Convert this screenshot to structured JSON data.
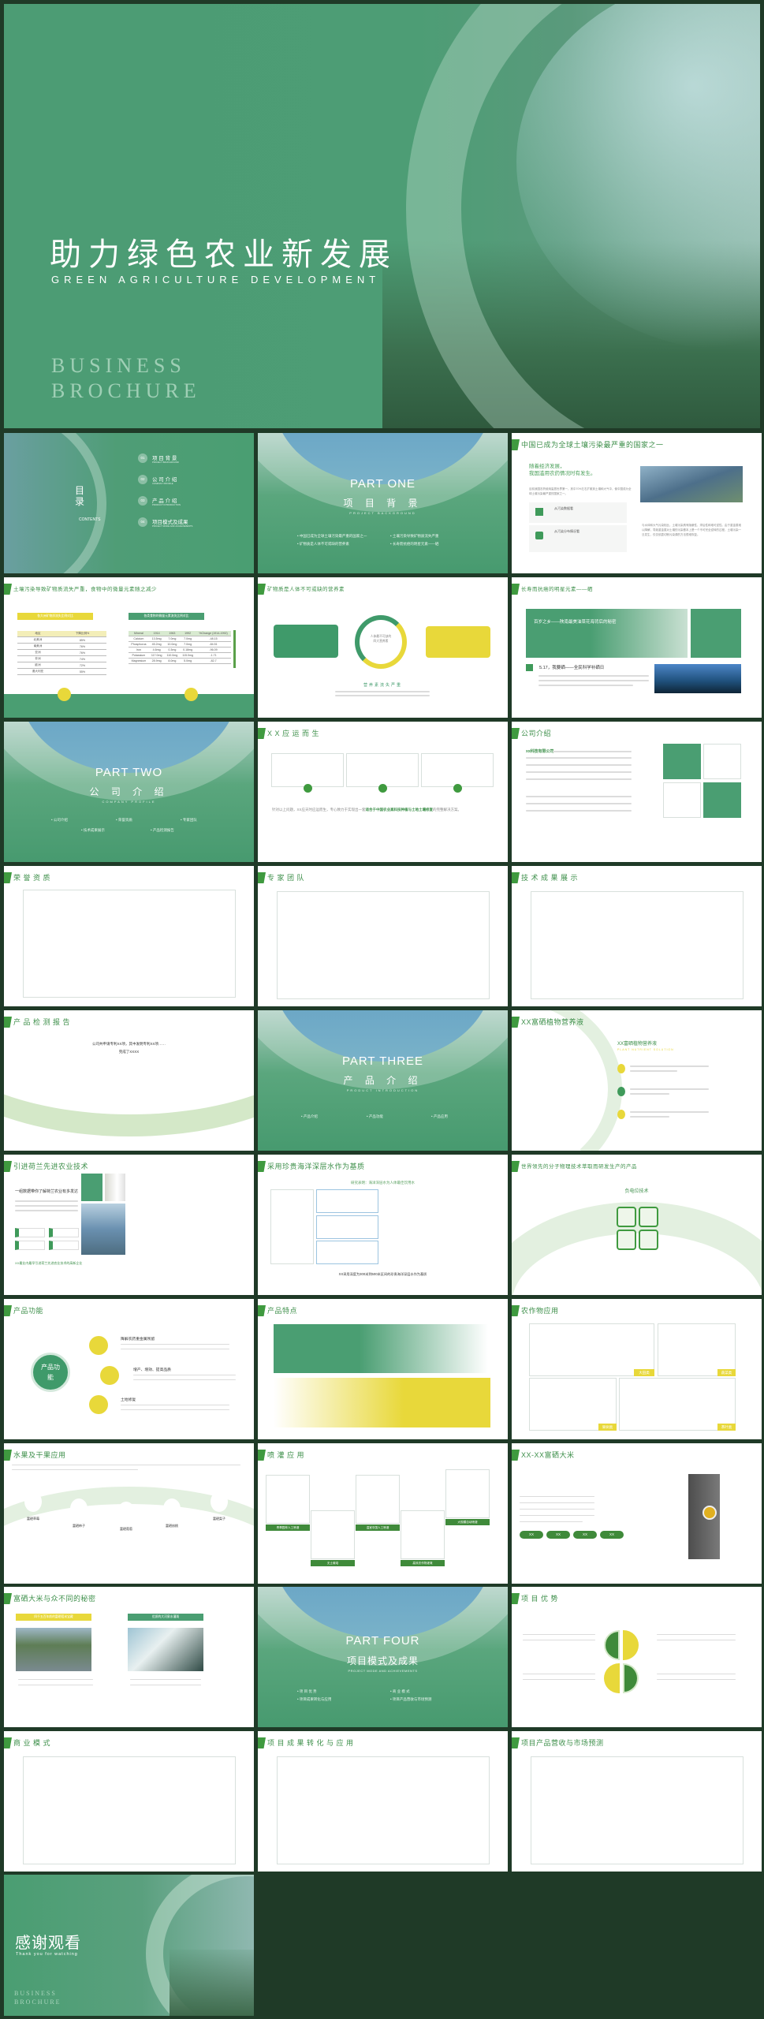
{
  "colors": {
    "background": "#1f3a27",
    "green": "#4a9e72",
    "title_green": "#3d8f4a",
    "yellow": "#e8d83a"
  },
  "cover": {
    "title": "助力绿色农业新发展",
    "subtitle": "GREEN AGRICULTURE DEVELOPMENT",
    "brand1": "BUSINESS",
    "brand2": "BROCHURE"
  },
  "contents": {
    "label_cn": "目录",
    "label_en": "CONTENTS",
    "items": [
      {
        "num": "01",
        "cn": "项 目 背 景",
        "en": "PROJECT BACKGROUND"
      },
      {
        "num": "02",
        "cn": "公 司 介 绍",
        "en": "COMPANY PROFILE"
      },
      {
        "num": "03",
        "cn": "产 品 介 绍",
        "en": "PRODUCT INTRODUCTION"
      },
      {
        "num": "04",
        "cn": "项目模式及成果",
        "en": "PROJECT MODE AND ACHIEVEMENTS"
      }
    ]
  },
  "part1": {
    "part": "PART ONE",
    "cn": "项 目 背 景",
    "en": "PROJECT BACKGROUND",
    "bullets": [
      "中国已成为全球土壤污染最严重的国家之一",
      "土壤污染导致矿物质流失严重",
      "矿物质是人体不可或缺的营养素",
      "长寿而抗癌的明星元素——硒"
    ]
  },
  "s3": {
    "title": "中国已成为全球土壤污染最严重的国家之一",
    "heading1": "随着经济发展，",
    "heading2": "我国滥用农药情况时有发生。",
    "para": "目前我国农药使用量居世界第一，其中70%左右扩散到土壤和大气中，使中国成为全球土壤污染最严重的国家之一。",
    "card1": "从污染数据看",
    "card2": "从污染分布情况看",
    "right": "与水体和大气污染相比，土壤污染具有隐蔽性、滞后性和难可逆性。由于重金属难以降解，导致重金属对土壤的污染基本上是一个不可完全逆转的过程，土壤污染一旦发生，仅仅依靠切断污染源的方法很难恢复。"
  },
  "s4": {
    "title": "土壤污染导致矿物质流失严重，食物中的微量元素随之减少",
    "left_tag": "各大洲矿物质流失比例对比",
    "left_head": [
      "地区",
      "下降比例%"
    ],
    "left_rows": [
      [
        "北美洲",
        "85%"
      ],
      [
        "南美洲",
        "76%"
      ],
      [
        "亚洲",
        "76%"
      ],
      [
        "非洲",
        "74%"
      ],
      [
        "欧洲",
        "72%"
      ],
      [
        "澳大利亚",
        "55%"
      ]
    ],
    "right_tag": "各类食物的微量元素流失比例对比",
    "right_head": [
      "Mineral",
      "1914",
      "1963",
      "1992",
      "%Change (1914-1992)"
    ],
    "right_rows": [
      [
        "Calcium",
        "13.5mg",
        "7.0mg",
        "7.0mg",
        "-48.15"
      ],
      [
        "Phosphorus",
        "45.2mg",
        "10.0mg",
        "7.0mg",
        "-84.51"
      ],
      [
        "Iron",
        "4.6mg",
        "0.3mg",
        "0.18mg",
        "-96.09"
      ],
      [
        "Potassium",
        "117.0mg",
        "110.0mg",
        "115.0mg",
        "-1.71"
      ],
      [
        "Magnesium",
        "28.9mg",
        "8.0mg",
        "5.0mg",
        "-82.7"
      ]
    ]
  },
  "s5": {
    "title": "矿物质是人体不可或缺的营养素",
    "center": "人体最不可缺的四大营养素",
    "caption": "营养素流失严重"
  },
  "s6": {
    "title": "长寿而抗癌的明星元素——硒",
    "banner": "百岁之乡——陕南最美油菜花海背后的秘密",
    "sub": "5.17，我要硒——全民科学补硒日"
  },
  "part2": {
    "part": "PART TWO",
    "cn": "公 司 介 绍",
    "en": "COMPANY PROFILE",
    "bullets": [
      "公司介绍",
      "荣誉资质",
      "专家团队",
      "技术成果展示",
      "产品检测报告"
    ]
  },
  "s8": {
    "title": "X X 应 运 而 生",
    "text": "针对以上问题，XX应天时应运而生，专心致力于实现出一套",
    "highlight": "适合于中国农业高科技种植与土地土壤修复",
    "tail": "的完整解决方案。"
  },
  "s9": {
    "title": "公司介绍",
    "company": "xx科技有限公司"
  },
  "s10": {
    "title": "荣 誉 资 质"
  },
  "s11": {
    "title": "专 家 团 队"
  },
  "s12": {
    "title": "技 术 成 果 展 示"
  },
  "s13": {
    "title": "产 品 检 测 报 告",
    "line1": "公司共申请专利XX项，其中发明专利XX项……",
    "line2": "完成了XXXX"
  },
  "part3": {
    "part": "PART THREE",
    "cn": "产 品 介 绍",
    "en": "PRODUCT INTRODUCTION",
    "bullets": [
      "产品介绍",
      "产品功能",
      "产品应用"
    ]
  },
  "s15": {
    "title": "XX富硒植物营养液",
    "heading": "XX富硒植物营养液",
    "en": "PLANT NUTRIENT SOLUTION"
  },
  "s16": {
    "title": "引进荷兰先进农业技术",
    "heading": "一组数据带你了解荷兰农业有多发达",
    "footer": "XX最业内最早引进荷兰先进农业技术的高新企业"
  },
  "s17": {
    "title": "采用珍贵海洋深层水作为基质",
    "heading": "研究表明：海洋深层水为人体最佳饮用水",
    "footer": "XX采用深度为300米到500米区间的珍贵海洋深层水作为基质"
  },
  "s18": {
    "title": "世界领先的分子物理技术萃取而研发生产的产品",
    "heading": "负电位技术"
  },
  "s19": {
    "title": "产品功能",
    "center": "产品功能",
    "items": [
      "降解农药重金属残留",
      "增产、增效、提高品质",
      "土地修复"
    ]
  },
  "s20": {
    "title": "产品特点"
  },
  "s21": {
    "title": "农作物应用",
    "tags": [
      "大田类",
      "蔬菜类",
      "果树类",
      "茶叶类"
    ]
  },
  "s22": {
    "title": "水果及干果应用",
    "labels": [
      "富硒草莓",
      "富硒柿子",
      "富硒葡萄",
      "富硒核桃",
      "富硒梨子"
    ]
  },
  "s23": {
    "title": "喷 灌 应 用",
    "tags": [
      "青翠园林人工喷灌",
      "无土栽培",
      "温室中国人工喷灌",
      "高效农作物灌溉",
      "大规模自动喷灌"
    ]
  },
  "s24": {
    "title": "XX-XX富硒大米",
    "buttons": [
      "XX",
      "XX",
      "XX",
      "XX"
    ]
  },
  "s25": {
    "title": "富硒大米与众不同的秘密",
    "tag1": "四千五百年前的富硒稻米宝藏",
    "tag2": "优质的大河泉水灌溉"
  },
  "part4": {
    "part": "PART FOUR",
    "cn": "项目模式及成果",
    "en": "PROJECT MODE AND ACHIEVEMENTS",
    "bullets": [
      "项 目 优 势",
      "商 业 模 式",
      "项目成果转化与应用",
      "项目产品营收与市场预测"
    ]
  },
  "s27": {
    "title": "项 目 优 势"
  },
  "s28": {
    "title": "商 业 模 式"
  },
  "s29": {
    "title": "项 目 成 果 转 化 与 应 用"
  },
  "s30": {
    "title": "项目产品营收与市场预测"
  },
  "thanks": {
    "title": "感谢观看",
    "en": "Thank you for watching",
    "brand1": "BUSINESS",
    "brand2": "BROCHURE"
  }
}
